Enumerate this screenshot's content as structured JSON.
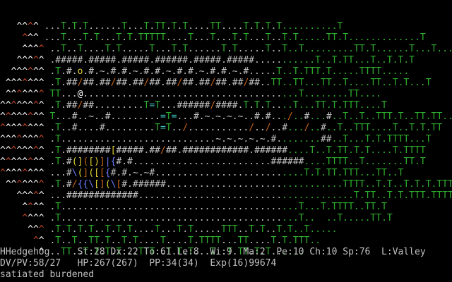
{
  "colors": {
    "background": "#000000",
    "tree": "#2fae2f",
    "mountain": "#ffffff",
    "mountain_red": "#d04a2a",
    "wall": "#c0c0c0",
    "player": "#ffffff",
    "item_yellow": "#e0d030",
    "item_orange": "#c86418",
    "item_blue": "#6a7aff",
    "item_cyan": "#40c8c8",
    "status_text": "#c0c0c0"
  },
  "map_rows": [
    "   ^^^^ ...T.T.T......T...T.TT.T.T....TT....T.T.T.T..........T",
    "    ^^^ ...T...T.T...T.T.TTTTT....T...T...T.T...T..T.T.....TT.T.............T",
    "    ^^^^ ..T..T....T.T.....T...T.T......T.T.....T..T..T.........TT.T......T...T....T",
    "   ^^^^^ .#####.#####.#####.######.#####.#####...........T..T.TT...T..T.T.T",
    "  ^^^^^^ .T.#.o.#.~.#.#.~.#.#.~.#.#.~.#.#.~.#.....T..T.TTT.T.....TTTT.....",
    " ^^^^^^^ .T.##/##.##/##.##/##.##/##.##/##.##/##..TT..TT...TT..T....TT..T.T...T",
    " ^^^^^^^ TT...@.......................................T........TT....",
    "^^^^^^^^ .T.##/##.........T=T...######/####.T.T.T....T...TT.T.TTT....T",
    "^^^^^^^^ T...#..~..#.........=T=...#.~.~.~.~..#.#.../..#...#..T..T..TTT.T..TT.TT...",
    "^^^^^^^^ .T..#....#.........T=T../.........../../..#.../..#..T..TTT....T..T.T.TT",
    "^^^^^^^^ .T............................~.~.~.~.~.#........##..T...T.T.TTTT...T",
    "^^^^^^^^ .T.########[#####.##/##.############.######....T..T.TT.T.T....T.TTTT",
    "^^^^^^^^ .T.#(]([)]|{#.#.........................######....TTTT..T.......TT.T",
    "^^^^^^^^ ...#\\(]([[{#.#.~.~#...........................T.T.TT.TTT...TT..T",
    " ^^^^^^^ .T.#/{{\\[](\\[#.######................................TTTT..T.T..T.T.T.TTT",
    "   ^^^^^ ...#############.......................................T.TT..T.T.TTT.TTTT.",
    "    ^^^^ .T...........................................T...T.TTTT..TT.T",
    "    ^^^^ .T...........................................T..  ..T.....TT.T",
    "     ^^^ .T.T.T.T..T.T.T....T...T.T.....TTT..T.T..T.T..T.....",
    "      ^^ .T..T..TT.T..T.T....T....T.TTTT...TT....T.T.TTT..",
    "       ^ ..TT..T.T.T.T...TTT..T.T.T...T..T.TT.T.T......"
  ],
  "status": {
    "line1": "HHedgehog     St:28 Dx:22 To:61 Le:8  Wi:9  Ma:2  Pe:10 Ch:10 Sp:76  L:Valley",
    "line2": "DV/PV:58/27   HP:267(267)  PP:34(34)  Exp(16)99674",
    "line3": "satiated burdened"
  }
}
